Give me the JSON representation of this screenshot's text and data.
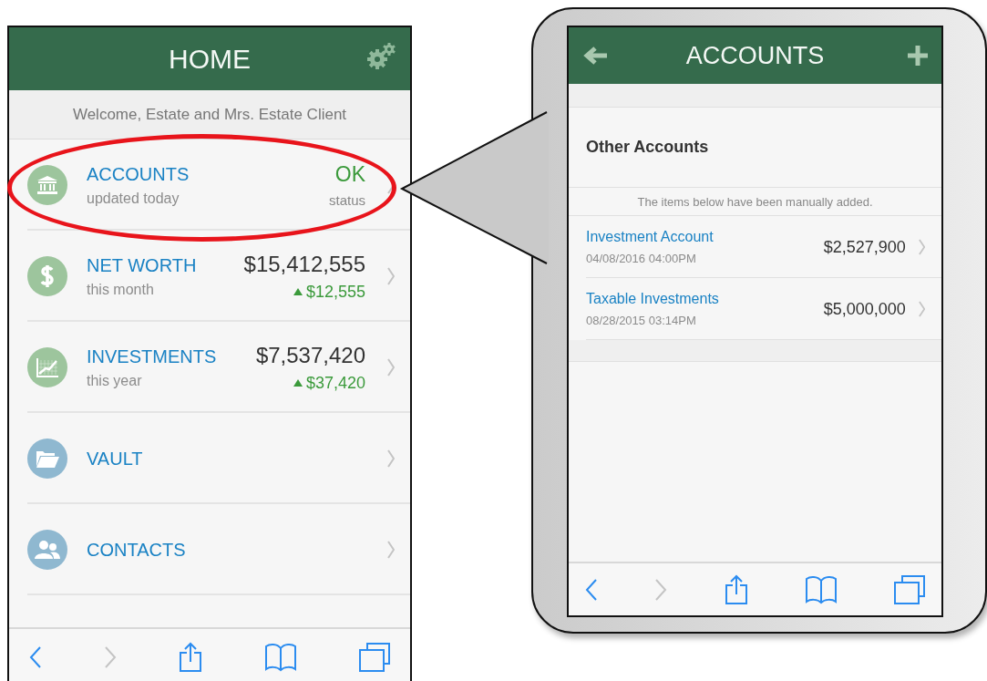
{
  "home": {
    "title": "HOME",
    "welcome": "Welcome, Estate and Mrs. Estate Client",
    "items": [
      {
        "kind": "status",
        "label": "ACCOUNTS",
        "sublabel": "updated today",
        "value": "OK",
        "value_note": "status",
        "color": "#9dc59d",
        "highlighted": true
      },
      {
        "kind": "amount",
        "label": "NET WORTH",
        "sublabel": "this month",
        "value": "$15,412,555",
        "change": "$12,555",
        "color": "#9dc59d",
        "highlighted": false
      },
      {
        "kind": "amount",
        "label": "INVESTMENTS",
        "sublabel": "this year",
        "value": "$7,537,420",
        "change": "$37,420",
        "color": "#9dc59d",
        "highlighted": false
      },
      {
        "kind": "link",
        "label": "VAULT",
        "color": "#8fb8d0",
        "highlighted": false
      },
      {
        "kind": "link",
        "label": "CONTACTS",
        "color": "#8fb8d0",
        "highlighted": false
      }
    ],
    "toolbar": [
      {
        "kind": "back",
        "disabled": false
      },
      {
        "kind": "forward",
        "disabled": true
      },
      {
        "kind": "share",
        "disabled": false
      },
      {
        "kind": "bookmarks",
        "disabled": false
      },
      {
        "kind": "tabs",
        "disabled": false
      }
    ]
  },
  "accounts_screen": {
    "title": "ACCOUNTS",
    "section": "Other Accounts",
    "note": "The items below have been manually added.",
    "rows": [
      {
        "name": "Investment Account",
        "date": "04/08/2016 04:00PM",
        "amount": "$2,527,900"
      },
      {
        "name": "Taxable Investments",
        "date": "08/28/2015 03:14PM",
        "amount": "$5,000,000"
      }
    ],
    "toolbar": [
      {
        "kind": "back",
        "disabled": false
      },
      {
        "kind": "forward",
        "disabled": true
      },
      {
        "kind": "share",
        "disabled": false
      },
      {
        "kind": "bookmarks",
        "disabled": false
      },
      {
        "kind": "tabs",
        "disabled": false
      }
    ]
  }
}
